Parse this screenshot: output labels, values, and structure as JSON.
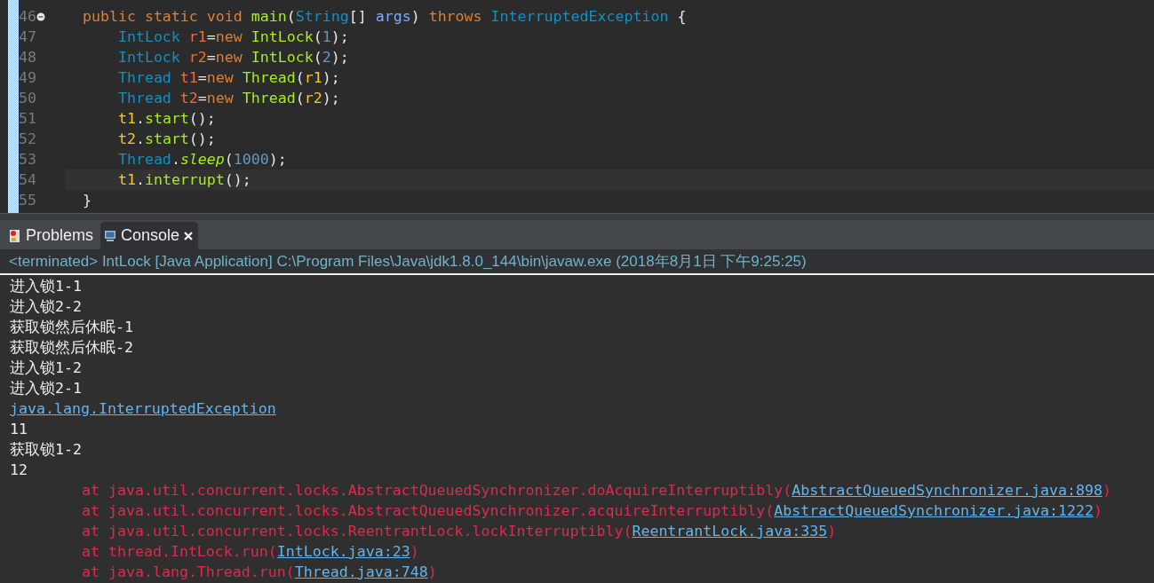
{
  "editor": {
    "lines": [
      {
        "number": "46",
        "fold": true,
        "current": false,
        "tokens": [
          {
            "kind": "kw",
            "text": "    public static void "
          },
          {
            "kind": "method",
            "text": "main"
          },
          {
            "kind": "punct",
            "text": "("
          },
          {
            "kind": "type",
            "text": "String"
          },
          {
            "kind": "punct",
            "text": "[] "
          },
          {
            "kind": "param",
            "text": "args"
          },
          {
            "kind": "punct",
            "text": ") "
          },
          {
            "kind": "kw",
            "text": "throws "
          },
          {
            "kind": "type",
            "text": "InterruptedException"
          },
          {
            "kind": "punct",
            "text": " {"
          }
        ]
      },
      {
        "number": "47",
        "fold": false,
        "current": false,
        "tokens": [
          {
            "kind": "type",
            "text": "        IntLock "
          },
          {
            "kind": "decl",
            "text": "r1"
          },
          {
            "kind": "punct",
            "text": "="
          },
          {
            "kind": "kw",
            "text": "new "
          },
          {
            "kind": "method",
            "text": "IntLock"
          },
          {
            "kind": "punct",
            "text": "("
          },
          {
            "kind": "num",
            "text": "1"
          },
          {
            "kind": "punct",
            "text": ");"
          }
        ]
      },
      {
        "number": "48",
        "fold": false,
        "current": false,
        "tokens": [
          {
            "kind": "type",
            "text": "        IntLock "
          },
          {
            "kind": "decl",
            "text": "r2"
          },
          {
            "kind": "punct",
            "text": "="
          },
          {
            "kind": "kw",
            "text": "new "
          },
          {
            "kind": "method",
            "text": "IntLock"
          },
          {
            "kind": "punct",
            "text": "("
          },
          {
            "kind": "num",
            "text": "2"
          },
          {
            "kind": "punct",
            "text": ");"
          }
        ]
      },
      {
        "number": "49",
        "fold": false,
        "current": false,
        "tokens": [
          {
            "kind": "type",
            "text": "        Thread "
          },
          {
            "kind": "decl",
            "text": "t1"
          },
          {
            "kind": "punct",
            "text": "="
          },
          {
            "kind": "kw",
            "text": "new "
          },
          {
            "kind": "method",
            "text": "Thread"
          },
          {
            "kind": "punct",
            "text": "("
          },
          {
            "kind": "local",
            "text": "r1"
          },
          {
            "kind": "punct",
            "text": ");"
          }
        ]
      },
      {
        "number": "50",
        "fold": false,
        "current": false,
        "tokens": [
          {
            "kind": "type",
            "text": "        Thread "
          },
          {
            "kind": "decl",
            "text": "t2"
          },
          {
            "kind": "punct",
            "text": "="
          },
          {
            "kind": "kw",
            "text": "new "
          },
          {
            "kind": "method",
            "text": "Thread"
          },
          {
            "kind": "punct",
            "text": "("
          },
          {
            "kind": "local",
            "text": "r2"
          },
          {
            "kind": "punct",
            "text": ");"
          }
        ]
      },
      {
        "number": "51",
        "fold": false,
        "current": false,
        "tokens": [
          {
            "kind": "local",
            "text": "        t1"
          },
          {
            "kind": "punct",
            "text": "."
          },
          {
            "kind": "method",
            "text": "start"
          },
          {
            "kind": "punct",
            "text": "();"
          }
        ]
      },
      {
        "number": "52",
        "fold": false,
        "current": false,
        "tokens": [
          {
            "kind": "local",
            "text": "        t2"
          },
          {
            "kind": "punct",
            "text": "."
          },
          {
            "kind": "method",
            "text": "start"
          },
          {
            "kind": "punct",
            "text": "();"
          }
        ]
      },
      {
        "number": "53",
        "fold": false,
        "current": false,
        "tokens": [
          {
            "kind": "type",
            "text": "        Thread"
          },
          {
            "kind": "punct",
            "text": "."
          },
          {
            "kind": "static",
            "text": "sleep"
          },
          {
            "kind": "punct",
            "text": "("
          },
          {
            "kind": "num",
            "text": "1000"
          },
          {
            "kind": "punct",
            "text": ");"
          }
        ]
      },
      {
        "number": "54",
        "fold": false,
        "current": true,
        "tokens": [
          {
            "kind": "local",
            "text": "        t1"
          },
          {
            "kind": "punct",
            "text": "."
          },
          {
            "kind": "method",
            "text": "interrupt"
          },
          {
            "kind": "punct",
            "text": "();"
          }
        ]
      },
      {
        "number": "55",
        "fold": false,
        "current": false,
        "tokens": [
          {
            "kind": "punct",
            "text": "    }"
          }
        ]
      }
    ]
  },
  "tabs": [
    {
      "label": "Problems",
      "kind": "problems",
      "selected": false,
      "closable": false
    },
    {
      "label": "Console",
      "kind": "console",
      "selected": true,
      "closable": true
    }
  ],
  "console": {
    "header": "<terminated> IntLock [Java Application] C:\\Program Files\\Java\\jdk1.8.0_144\\bin\\javaw.exe (2018年8月1日 下午9:25:25)",
    "lines": [
      {
        "kind": "out",
        "text": "进入锁1-1"
      },
      {
        "kind": "out",
        "text": "进入锁2-2"
      },
      {
        "kind": "out",
        "text": "获取锁然后休眠-1"
      },
      {
        "kind": "out",
        "text": "获取锁然后休眠-2"
      },
      {
        "kind": "out",
        "text": "进入锁1-2"
      },
      {
        "kind": "out",
        "text": "进入锁2-1"
      },
      {
        "kind": "link",
        "text": "java.lang.InterruptedException"
      },
      {
        "kind": "out",
        "text": "11"
      },
      {
        "kind": "out",
        "text": "获取锁1-2"
      },
      {
        "kind": "out",
        "text": "12"
      },
      {
        "kind": "trace",
        "text": "at java.util.concurrent.locks.AbstractQueuedSynchronizer.doAcquireInterruptibly(",
        "link": "AbstractQueuedSynchronizer.java:898",
        "end": ")"
      },
      {
        "kind": "trace",
        "text": "at java.util.concurrent.locks.AbstractQueuedSynchronizer.acquireInterruptibly(",
        "link": "AbstractQueuedSynchronizer.java:1222",
        "end": ")"
      },
      {
        "kind": "trace",
        "text": "at java.util.concurrent.locks.ReentrantLock.lockInterruptibly(",
        "link": "ReentrantLock.java:335",
        "end": ")"
      },
      {
        "kind": "trace",
        "text": "at thread.IntLock.run(",
        "link": "IntLock.java:23",
        "end": ")"
      },
      {
        "kind": "trace",
        "text": "at java.lang.Thread.run(",
        "link": "Thread.java:748",
        "end": ")"
      }
    ]
  }
}
